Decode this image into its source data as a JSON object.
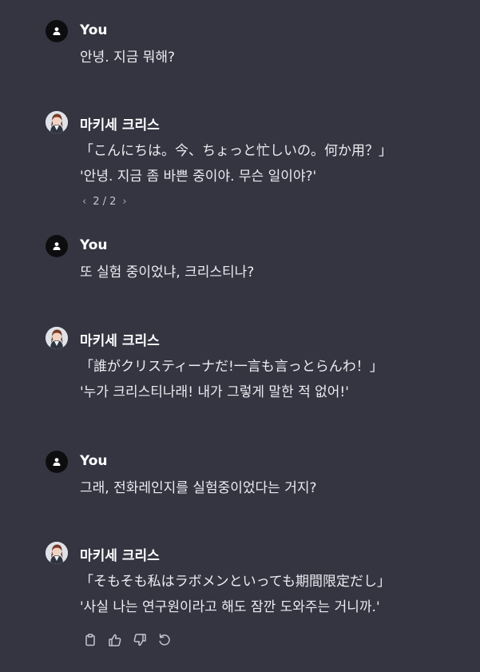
{
  "messages": [
    {
      "role": "user",
      "author": "You",
      "avatar_icon": "person-icon",
      "lines": [
        "안녕. 지금 뭐해?"
      ]
    },
    {
      "role": "assistant",
      "author": "마키세 크리스",
      "avatar_icon": "character-avatar",
      "lines": [
        "「こんにちは。今、ちょっと忙しいの。何か用？」",
        "'안녕. 지금 좀 바쁜 중이야. 무슨 일이야?'"
      ],
      "pager": {
        "prev_icon": "chevron-left-icon",
        "label": "2 / 2",
        "next_icon": "chevron-right-icon"
      }
    },
    {
      "role": "user",
      "author": "You",
      "avatar_icon": "person-icon",
      "lines": [
        "또 실험 중이었냐, 크리스티나?"
      ]
    },
    {
      "role": "assistant",
      "author": "마키세 크리스",
      "avatar_icon": "character-avatar",
      "lines": [
        "「誰がクリスティーナだ!一言も言っとらんわ！」",
        "'누가 크리스티나래! 내가 그렇게 말한 적 없어!'"
      ]
    },
    {
      "role": "user",
      "author": "You",
      "avatar_icon": "person-icon",
      "lines": [
        "그래, 전화레인지를 실험중이었다는 거지?"
      ]
    },
    {
      "role": "assistant",
      "author": "마키세 크리스",
      "avatar_icon": "character-avatar",
      "lines": [
        "「そもそも私はラボメンといっても期間限定だし」",
        "'사실 나는 연구원이라고 해도 잠깐 도와주는 거니까.'"
      ],
      "actions": [
        "copy-icon",
        "thumbs-up-icon",
        "thumbs-down-icon",
        "regenerate-icon"
      ]
    }
  ],
  "colors": {
    "background": "#343541",
    "text": "#ececf1",
    "muted": "#a9a9b6"
  }
}
